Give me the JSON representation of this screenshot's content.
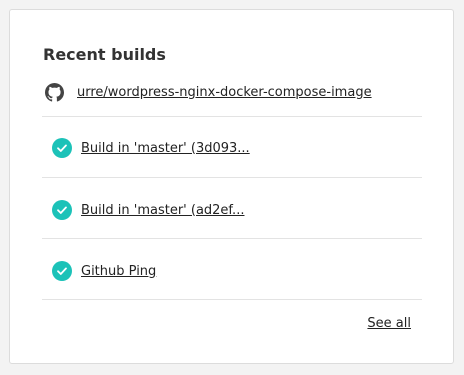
{
  "card": {
    "title": "Recent builds",
    "repo": {
      "icon": "github-icon",
      "name": "urre/wordpress-nginx-docker-compose-image"
    },
    "builds": [
      {
        "icon": "check-circle-icon",
        "status": "success",
        "label": "Build in 'master' (3d093..."
      },
      {
        "icon": "check-circle-icon",
        "status": "success",
        "label": "Build in 'master' (ad2ef..."
      },
      {
        "icon": "check-circle-icon",
        "status": "success",
        "label": "Github Ping"
      }
    ],
    "see_all_label": "See all"
  },
  "colors": {
    "success": "#1cc2b8",
    "text": "#222222",
    "divider": "#e3e3e3"
  }
}
